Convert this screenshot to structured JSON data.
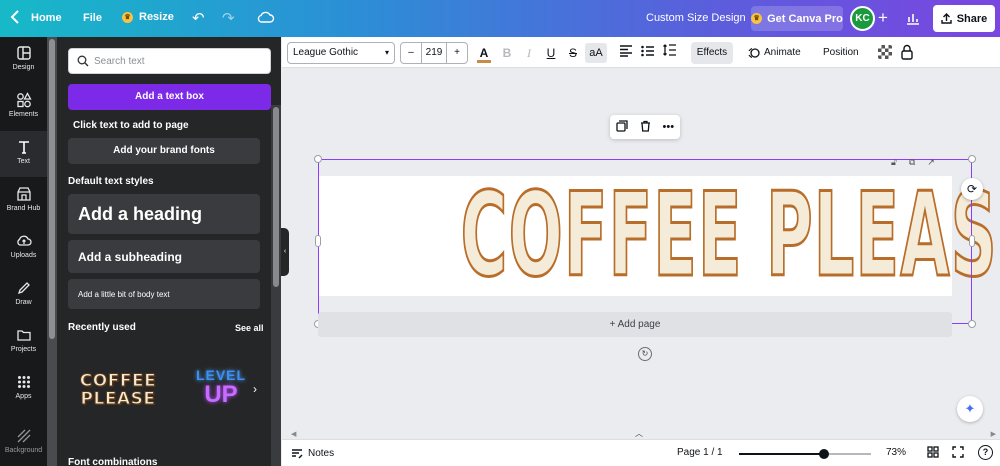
{
  "header": {
    "home_label": "Home",
    "file_label": "File",
    "resize_label": "Resize",
    "design_title": "Custom Size Design",
    "pro_label": "Get Canva Pro",
    "avatar_initials": "KC",
    "share_label": "Share"
  },
  "rail": {
    "items": [
      {
        "label": "Design",
        "icon": "design-icon"
      },
      {
        "label": "Elements",
        "icon": "elements-icon"
      },
      {
        "label": "Text",
        "icon": "text-icon"
      },
      {
        "label": "Brand Hub",
        "icon": "brand-hub-icon"
      },
      {
        "label": "Uploads",
        "icon": "uploads-icon"
      },
      {
        "label": "Draw",
        "icon": "draw-icon"
      },
      {
        "label": "Projects",
        "icon": "projects-icon"
      },
      {
        "label": "Apps",
        "icon": "apps-icon"
      },
      {
        "label": "Background",
        "icon": "background-icon"
      }
    ],
    "active_index": 2
  },
  "panel": {
    "search_placeholder": "Search text",
    "add_text_box": "Add a text box",
    "click_hint": "Click text to add to page",
    "brand_fonts": "Add your brand fonts",
    "default_styles_label": "Default text styles",
    "heading": "Add a heading",
    "subheading": "Add a subheading",
    "body": "Add a little bit of body text",
    "recently_used": "Recently used",
    "see_all": "See all",
    "recent_1_line1": "COFFEE",
    "recent_1_line2": "PLEASE",
    "recent_2_line1": "LEVEL",
    "recent_2_line2": "UP",
    "font_combinations": "Font combinations"
  },
  "toolbar": {
    "font_family": "League Gothic",
    "font_size": "219",
    "minus": "–",
    "plus": "+",
    "text_color_glyph": "A",
    "bold_glyph": "B",
    "italic_glyph": "I",
    "underline_glyph": "U",
    "strike_glyph": "S",
    "case_glyph": "aA",
    "effects_label": "Effects",
    "animate_label": "Animate",
    "position_label": "Position",
    "text_color_hex": "#c98a4a"
  },
  "canvas": {
    "text": "COFFEE PLEASE",
    "text_fill": "#f4ecd8",
    "text_stroke": "#b86e2a",
    "selection_color": "#8b3dff",
    "add_page_label": "+ Add page"
  },
  "footer": {
    "notes_label": "Notes",
    "page_indicator": "Page 1 / 1",
    "zoom_percent": 73,
    "zoom_label": "73%",
    "zoom_min": 10,
    "zoom_max": 500
  }
}
